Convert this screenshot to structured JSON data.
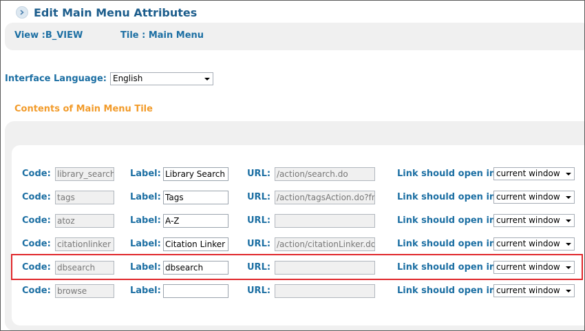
{
  "header": {
    "title": "Edit Main Menu Attributes"
  },
  "view": {
    "view_text": "View :B_VIEW",
    "tile_text": "Tile : Main Menu"
  },
  "language": {
    "label": "Interface Language:",
    "selected": "English"
  },
  "section": {
    "title": "Contents of Main Menu Tile"
  },
  "labels": {
    "code": "Code:",
    "label": "Label:",
    "url": "URL:",
    "open_in": "Link should open in:"
  },
  "rows": [
    {
      "code": "library_search",
      "label": "Library Search",
      "url": "/action/search.do",
      "open_in": "current window"
    },
    {
      "code": "tags",
      "label": "Tags",
      "url": "/action/tagsAction.do?fn=",
      "open_in": "current window"
    },
    {
      "code": "atoz",
      "label": "A-Z",
      "url": "",
      "open_in": "current window"
    },
    {
      "code": "citationlinker",
      "label": "Citation Linker",
      "url": "/action/citationLinker.do?",
      "open_in": "current window"
    },
    {
      "code": "dbsearch",
      "label": "dbsearch",
      "url": "",
      "open_in": "current window"
    },
    {
      "code": "browse",
      "label": "",
      "url": "",
      "open_in": "current window"
    }
  ],
  "colors": {
    "heading": "#1c5d8c",
    "label": "#1c6fa3",
    "section": "#f29b2a",
    "highlight": "#e0262a"
  }
}
